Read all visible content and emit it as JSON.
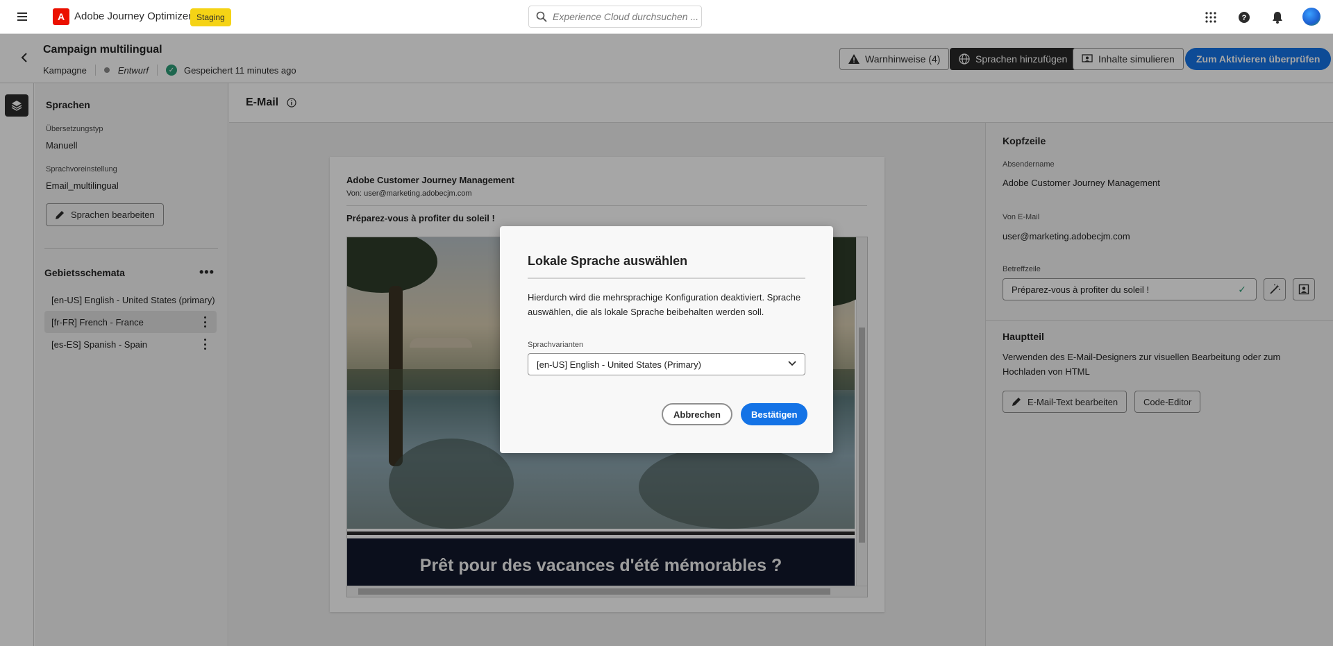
{
  "topnav": {
    "app_name": "Adobe Journey Optimizer",
    "logo_letter": "A",
    "env_badge": "Staging",
    "search_placeholder": "Experience Cloud durchsuchen ..."
  },
  "campaign": {
    "title": "Campaign multilingual",
    "type": "Kampagne",
    "status": "Entwurf",
    "saved": "Gespeichert 11 minutes ago",
    "buttons": {
      "warnings": "Warnhinweise (4)",
      "add_languages": "Sprachen hinzufügen",
      "simulate": "Inhalte simulieren",
      "review": "Zum Aktivieren überprüfen"
    }
  },
  "left_panel": {
    "title": "Sprachen",
    "translation_type_label": "Übersetzungstyp",
    "translation_type_value": "Manuell",
    "preset_label": "Sprachvoreinstellung",
    "preset_value": "Email_multilingual",
    "edit_button": "Sprachen bearbeiten",
    "locales_title": "Gebietsschemata",
    "locales": [
      {
        "label": "[en-US] English - United States (primary)",
        "selected": false
      },
      {
        "label": "[fr-FR] French - France",
        "selected": true
      },
      {
        "label": "[es-ES] Spanish - Spain",
        "selected": false
      }
    ]
  },
  "center": {
    "title": "E-Mail",
    "email": {
      "sender_name": "Adobe Customer Journey Management",
      "from_line": "Von: user@marketing.adobecjm.com",
      "subject": "Préparez-vous à profiter du soleil !",
      "banner_text": "Prêt pour des vacances d'été mémorables ?"
    }
  },
  "right_panel": {
    "header_title": "Kopfzeile",
    "sender_name_label": "Absendername",
    "sender_name_value": "Adobe Customer Journey Management",
    "from_email_label": "Von E-Mail",
    "from_email_value": "user@marketing.adobecjm.com",
    "subject_label": "Betreffzeile",
    "subject_value": "Préparez-vous à profiter du soleil !",
    "body_title": "Hauptteil",
    "body_text": "Verwenden des E-Mail-Designers zur visuellen Bearbeitung oder zum Hochladen von HTML",
    "edit_email_button": "E-Mail-Text bearbeiten",
    "code_editor_button": "Code-Editor"
  },
  "modal": {
    "title": "Lokale Sprache auswählen",
    "description": "Hierdurch wird die mehrsprachige Konfiguration deaktiviert. Sprache auswählen, die als lokale Sprache beibehalten werden soll.",
    "select_label": "Sprachvarianten",
    "select_value": "[en-US] English - United States (Primary)",
    "cancel": "Abbrechen",
    "confirm": "Bestätigen"
  },
  "colors": {
    "accent": "#1473e6",
    "brand_red": "#eb1000",
    "staging_yellow": "#f5d315",
    "success_green": "#2d9d78"
  }
}
